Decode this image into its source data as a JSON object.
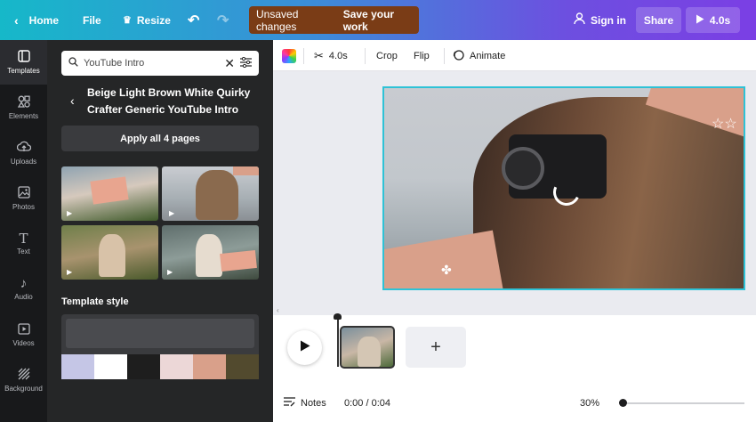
{
  "topbar": {
    "home": "Home",
    "file": "File",
    "resize": "Resize",
    "unsaved": "Unsaved changes",
    "save": "Save your work",
    "sign_in": "Sign in",
    "share": "Share",
    "duration": "4.0s"
  },
  "rail": [
    {
      "label": "Templates",
      "icon": "templates-icon"
    },
    {
      "label": "Elements",
      "icon": "elements-icon"
    },
    {
      "label": "Uploads",
      "icon": "uploads-icon"
    },
    {
      "label": "Photos",
      "icon": "photos-icon"
    },
    {
      "label": "Text",
      "icon": "text-icon"
    },
    {
      "label": "Audio",
      "icon": "audio-icon"
    },
    {
      "label": "Videos",
      "icon": "videos-icon"
    },
    {
      "label": "Background",
      "icon": "background-icon"
    }
  ],
  "panel": {
    "search_value": "YouTube Intro",
    "template_title": "Beige Light Brown White Quirky Crafter Generic YouTube Intro",
    "apply_button": "Apply all 4 pages",
    "style_heading": "Template style",
    "swatches": [
      "#c5c6e6",
      "#ffffff",
      "#1e1e1e",
      "#ecd7d7",
      "#d9a08a",
      "#524a2e"
    ]
  },
  "toolbar": {
    "duration": "4.0s",
    "crop": "Crop",
    "flip": "Flip",
    "animate": "Animate"
  },
  "timeline": {
    "notes": "Notes",
    "time": "0:00 / 0:04",
    "zoom": "30%"
  },
  "colors": {
    "accent_cyan": "#2ec2d6",
    "unsaved_bg": "#7a3c16",
    "panel_bg": "#252627",
    "rail_bg": "#18191b"
  }
}
